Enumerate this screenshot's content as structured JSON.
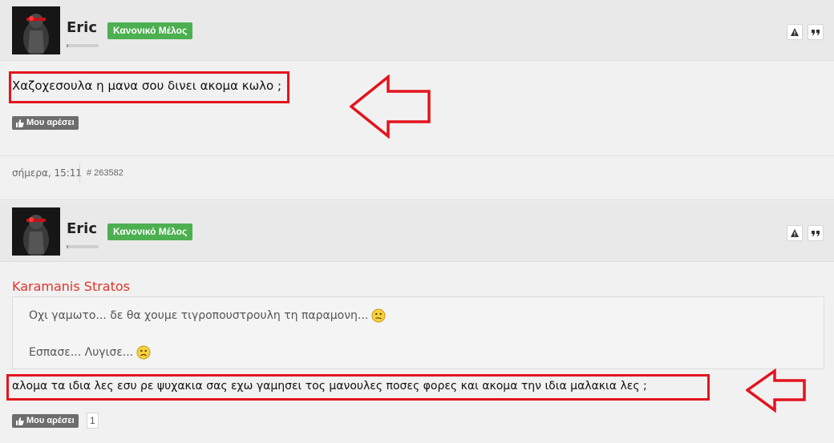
{
  "posts": [
    {
      "username": "Eric",
      "rank": "Κανονικό Μέλος",
      "text": "Χαζοχεσουλα η μανα σου δινει ακομα κωλο ;",
      "like_label": "Μου αρέσει",
      "date": "σήμερα, 15:11",
      "post_id": "# 263582"
    },
    {
      "username": "Eric",
      "rank": "Κανονικό Μέλος",
      "quote": {
        "author": "Karamanis Stratos",
        "line1": "Οχι γαμωτο... δε θα χουμε τιγροπουστρουλη τη παραμονη...",
        "line2": "Εσπασε... Λυγισε..."
      },
      "text": "αλομα τα ιδια λες εσυ ρε ψυχακια σας εχω γαμησει τος μανουλες ποσες φορες και ακομα την ιδια μαλακια λες ;",
      "like_label": "Μου αρέσει",
      "like_count": "1"
    }
  ],
  "icons": {
    "report": "warning-icon",
    "quote": "quote-icon",
    "like": "thumbs-up-icon",
    "smiley_confused": "confused-smiley-icon",
    "smiley_sad": "sad-smiley-icon"
  },
  "colors": {
    "badge": "#4caf50",
    "annotation": "#e3141d",
    "quote_author": "#e0332b"
  }
}
